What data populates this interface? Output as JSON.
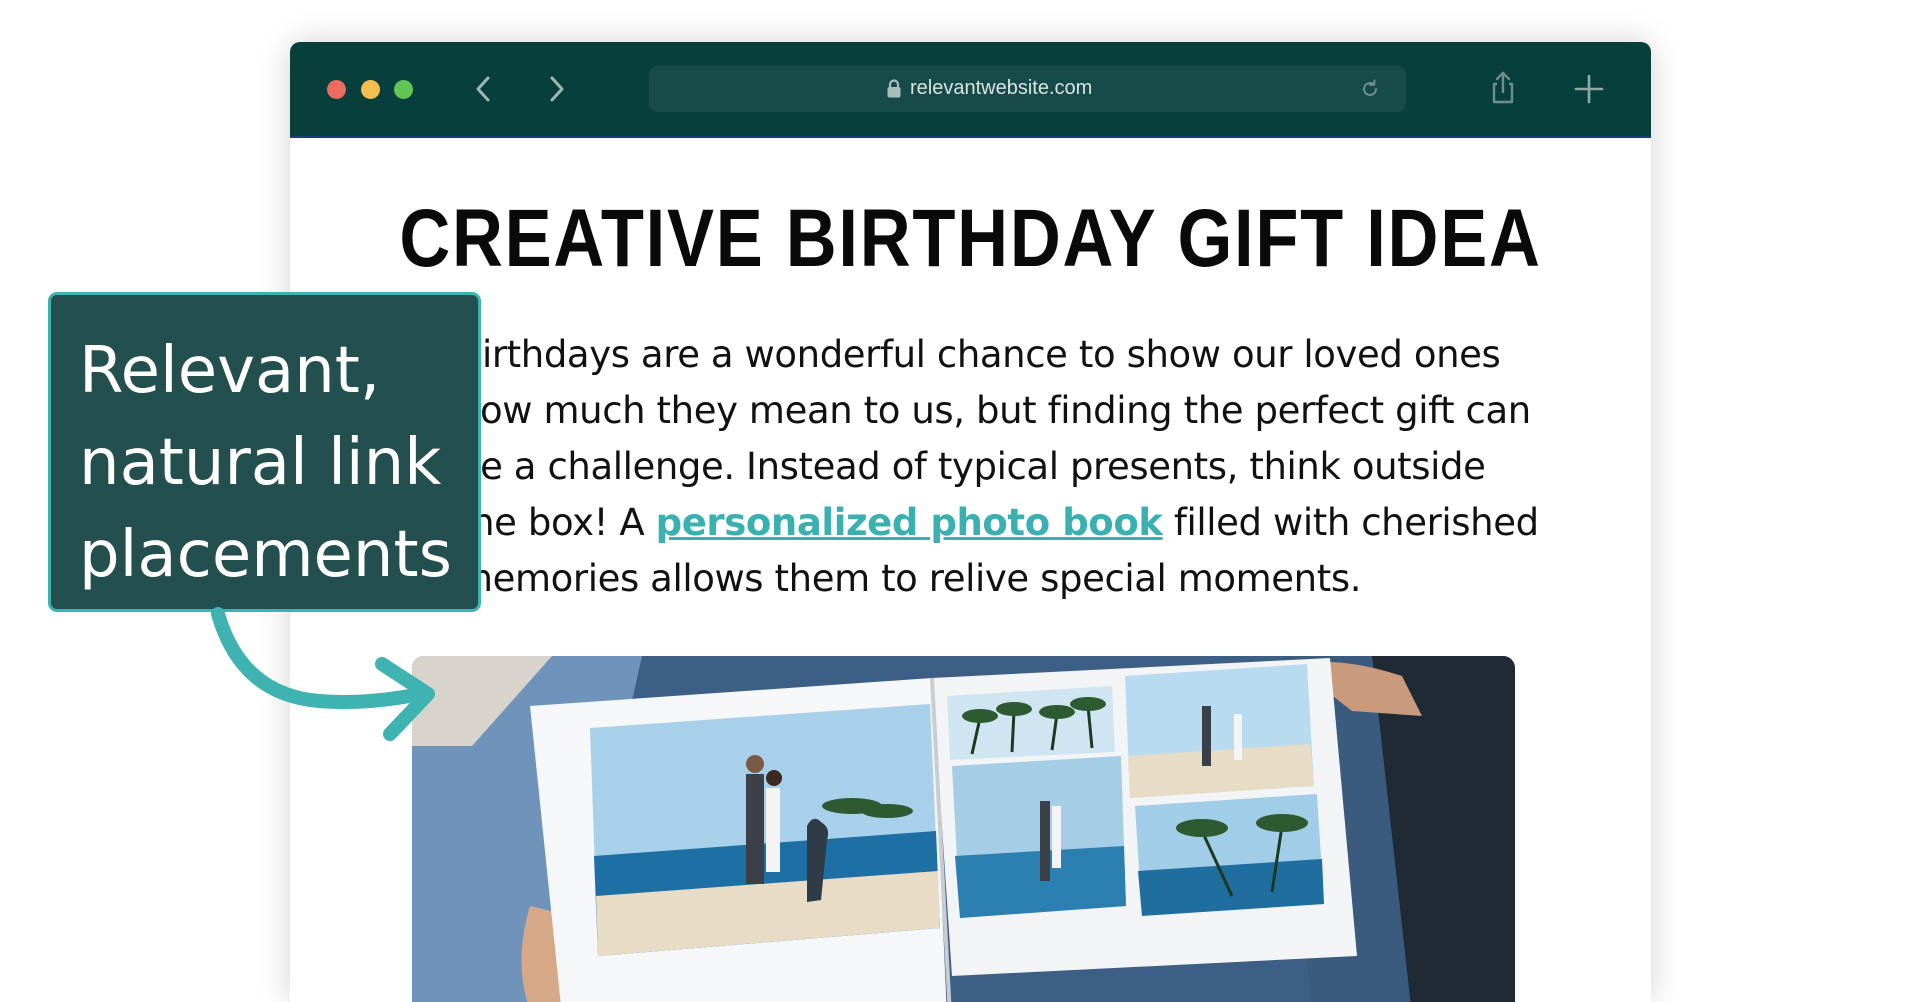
{
  "browser": {
    "url": "relevantwebsite.com",
    "icons": [
      "back-arrow-icon",
      "forward-arrow-icon",
      "lock-icon",
      "reload-icon",
      "share-icon",
      "new-tab-plus-icon"
    ],
    "colors": {
      "titlebar": "#073f3d",
      "urlbar": "#164b49",
      "close": "#ed6a5e",
      "minimize": "#f4bf4f",
      "zoom": "#61c554"
    }
  },
  "article": {
    "title": "CREATIVE BIRTHDAY GIFT IDEA",
    "text_before_link": "Birthdays are a wonderful chance to show our loved ones how much they mean to us, but finding the perfect gift can be a challenge. Instead of typical presents, think outside the box! A ",
    "link_text": "personalized photo book",
    "text_after_link": " filled with cherished memories allows them to relive special moments.",
    "link_color": "#3ab0b0"
  },
  "callout": {
    "lines": [
      "Relevant,",
      "natural link",
      "placements"
    ],
    "colors": {
      "background": "#234f4f",
      "border": "#3fb2b2",
      "arrow": "#3fb2b2"
    }
  }
}
